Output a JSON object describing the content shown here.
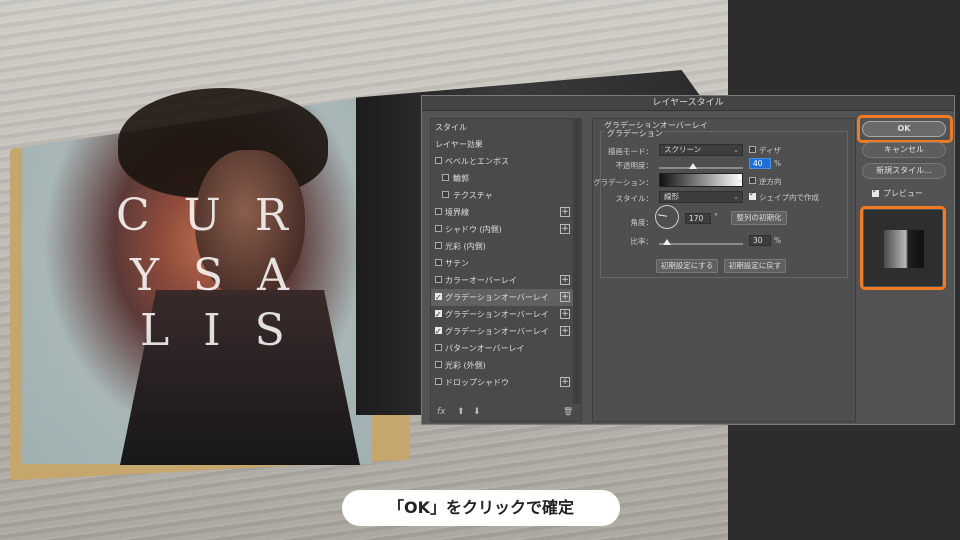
{
  "dialog": {
    "title": "レイヤースタイル",
    "effects": [
      {
        "label": "スタイル",
        "indent": false,
        "checkbox": null,
        "plus": false,
        "active": false
      },
      {
        "label": "レイヤー効果",
        "indent": false,
        "checkbox": null,
        "plus": false,
        "active": false
      },
      {
        "label": "ベベルとエンボス",
        "indent": false,
        "checkbox": false,
        "plus": false,
        "active": false
      },
      {
        "label": "輪郭",
        "indent": true,
        "checkbox": false,
        "plus": false,
        "active": false
      },
      {
        "label": "テクスチャ",
        "indent": true,
        "checkbox": false,
        "plus": false,
        "active": false
      },
      {
        "label": "境界線",
        "indent": false,
        "checkbox": false,
        "plus": true,
        "active": false
      },
      {
        "label": "シャドウ (内側)",
        "indent": false,
        "checkbox": false,
        "plus": true,
        "active": false
      },
      {
        "label": "光彩 (内側)",
        "indent": false,
        "checkbox": false,
        "plus": false,
        "active": false
      },
      {
        "label": "サテン",
        "indent": false,
        "checkbox": false,
        "plus": false,
        "active": false
      },
      {
        "label": "カラーオーバーレイ",
        "indent": false,
        "checkbox": false,
        "plus": true,
        "active": false
      },
      {
        "label": "グラデーションオーバーレイ",
        "indent": false,
        "checkbox": true,
        "plus": true,
        "active": true
      },
      {
        "label": "グラデーションオーバーレイ",
        "indent": false,
        "checkbox": true,
        "plus": true,
        "active": false
      },
      {
        "label": "グラデーションオーバーレイ",
        "indent": false,
        "checkbox": true,
        "plus": true,
        "active": false
      },
      {
        "label": "パターンオーバーレイ",
        "indent": false,
        "checkbox": false,
        "plus": false,
        "active": false
      },
      {
        "label": "光彩 (外側)",
        "indent": false,
        "checkbox": false,
        "plus": false,
        "active": false
      },
      {
        "label": "ドロップシャドウ",
        "indent": false,
        "checkbox": false,
        "plus": true,
        "active": false
      }
    ],
    "footer": {
      "fx": "fx",
      "up": "⬆",
      "down": "⬇",
      "trash": "🗑"
    },
    "center": {
      "section_title": "グラデーションオーバーレイ",
      "group_title": "グラデーション",
      "blend_mode_label": "描画モード：",
      "blend_mode_value": "スクリーン",
      "dither_label": "ディザ",
      "opacity_label": "不透明度：",
      "opacity_value": "40",
      "percent": "%",
      "gradient_label": "グラデーション：",
      "reverse_label": "逆方向",
      "style_label": "スタイル：",
      "style_value": "線形",
      "align_label": "シェイプ内で作成",
      "angle_label": "角度：",
      "angle_value": "170",
      "degree": "°",
      "reset_align_button": "整列の初期化",
      "scale_label": "比率：",
      "scale_value": "30",
      "make_default_button": "初期設定にする",
      "reset_default_button": "初期設定に戻す"
    },
    "right": {
      "ok": "OK",
      "cancel": "キャンセル",
      "new_style": "新規スタイル...",
      "preview_label": "プレビュー"
    }
  },
  "background": {
    "letters_row1": "C U R",
    "letters_row2": "Y   S A",
    "letters_row3": "L   I S"
  },
  "caption": "「OK」をクリックで確定",
  "colors": {
    "highlight": "#f07b22",
    "focus": "#1f6fd6"
  }
}
